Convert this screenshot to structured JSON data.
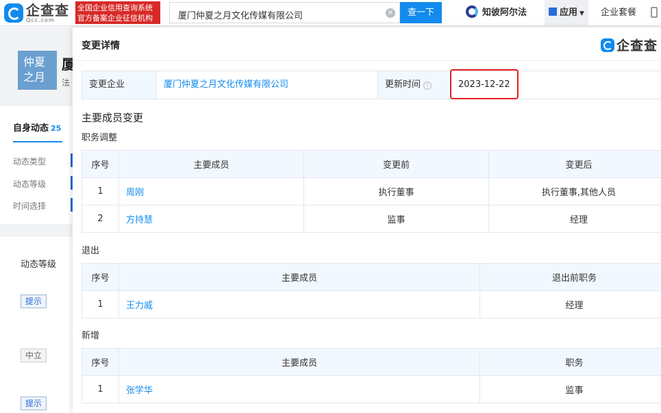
{
  "topbar": {
    "logo_name": "企查查",
    "logo_sub": "Qcc.com",
    "badge_line1": "全国企业信用查询系统",
    "badge_line2": "官方备案企业征信机构",
    "search_value": "厦门仲夏之月文化传媒有限公司",
    "search_button": "查一下",
    "nav_zbf": "知彼阿尔法",
    "nav_app": "应用",
    "nav_pkg": "企业套餐"
  },
  "background": {
    "avatar_text": "仲夏之月",
    "title": "厦",
    "subtitle": "法",
    "tab_label": "自身动态",
    "tab_count": "25",
    "filters": [
      "动态类型",
      "动态等级",
      "时间选择"
    ],
    "level_label": "动态等级",
    "tags": [
      "提示",
      "中立",
      "提示"
    ]
  },
  "modal": {
    "title": "变更详情",
    "logo_name": "企查查",
    "info": {
      "company_label": "变更企业",
      "company_value": "厦门仲夏之月文化传媒有限公司",
      "time_label": "更新时间",
      "time_value": "2023-12-22"
    },
    "section_title": "主要成员变更",
    "position_change": {
      "title": "职务调整",
      "headers": [
        "序号",
        "主要成员",
        "变更前",
        "变更后"
      ],
      "rows": [
        {
          "no": "1",
          "name": "周刚",
          "before": "执行董事",
          "after": "执行董事,其他人员"
        },
        {
          "no": "2",
          "name": "方持慧",
          "before": "监事",
          "after": "经理"
        }
      ]
    },
    "exit": {
      "title": "退出",
      "headers": [
        "序号",
        "主要成员",
        "退出前职务"
      ],
      "rows": [
        {
          "no": "1",
          "name": "王力威",
          "role": "经理"
        }
      ]
    },
    "added": {
      "title": "新增",
      "headers": [
        "序号",
        "主要成员",
        "职务"
      ],
      "rows": [
        {
          "no": "1",
          "name": "张学华",
          "role": "监事"
        }
      ]
    }
  },
  "colors": {
    "brand_blue": "#128bed",
    "highlight_red": "#e01f1f",
    "badge_red": "#d72a27"
  }
}
